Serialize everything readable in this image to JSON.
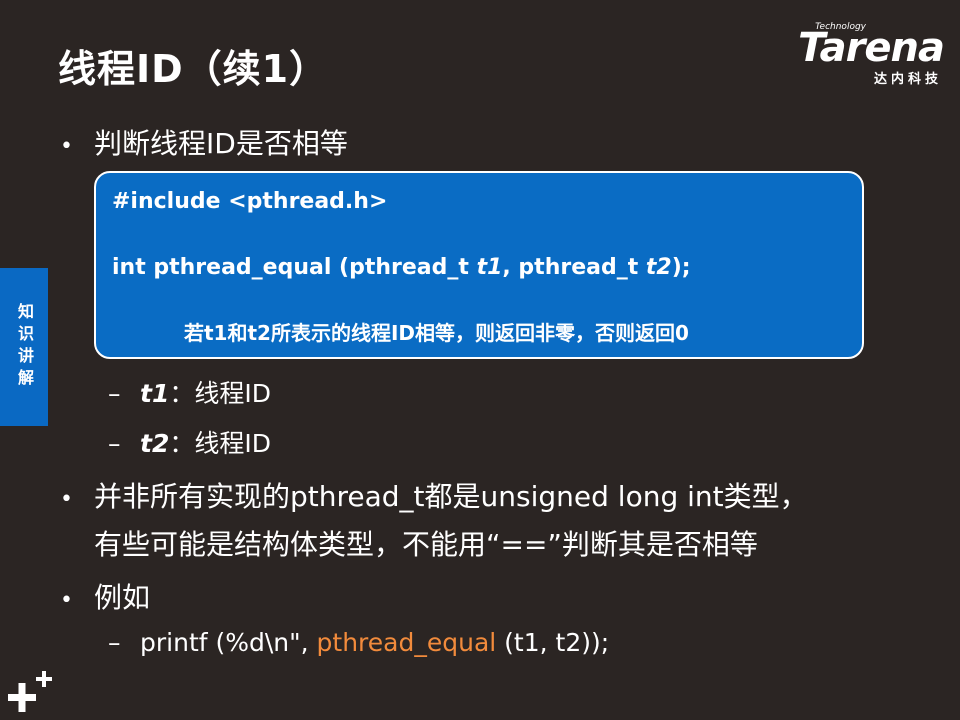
{
  "title": "线程ID（续1）",
  "logo": {
    "tech": "Technology",
    "word": "Tarena",
    "sub": "达内科技"
  },
  "side_tab": "知识讲解",
  "bullets": {
    "b1": "判断线程ID是否相等",
    "b2_line1": "并非所有实现的pthread_t都是unsigned long int类型，",
    "b2_line2": "有些可能是结构体类型，不能用“==”判断其是否相等",
    "b3": "例如",
    "bullet_symbol": "•",
    "dash_symbol": "–"
  },
  "code": {
    "line1": "#include <pthread.h>",
    "line2_prefix": "int pthread_equal (pthread_t ",
    "line2_t1": "t1",
    "line2_mid": ", pthread_t ",
    "line2_t2": "t2",
    "line2_suffix": ");",
    "note": "若t1和t2所表示的线程ID相等，则返回非零，否则返回0"
  },
  "params": [
    {
      "name": "t1",
      "desc": "：线程ID"
    },
    {
      "name": "t2",
      "desc": "：线程ID"
    }
  ],
  "example": {
    "prefix": "printf (%d\\n\", ",
    "func": "pthread_equal",
    "suffix": " (t1, t2));"
  },
  "colors": {
    "background": "#2b2523",
    "accent_blue": "#0a6cc4",
    "highlight_orange": "#f28b3c"
  }
}
